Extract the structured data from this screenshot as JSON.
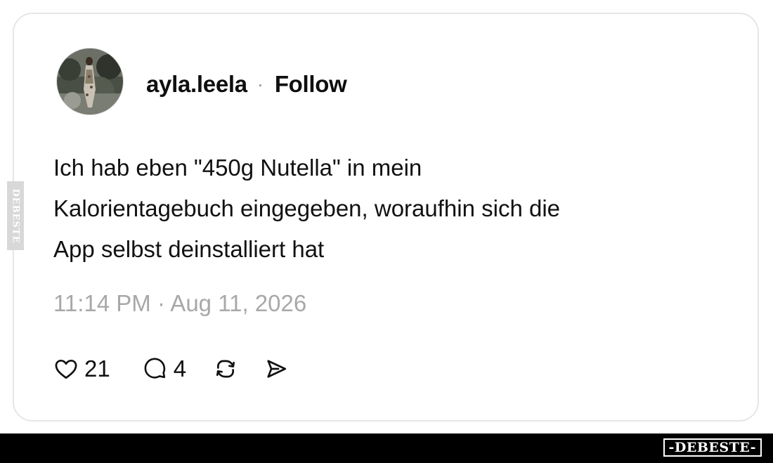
{
  "post": {
    "author": "ayla.leela",
    "separator": "·",
    "follow_label": "Follow",
    "text_lines": [
      "Ich hab eben \"450g Nutella\" in mein",
      "Kalorientagebuch eingegeben, woraufhin sich die",
      "App selbst deinstalliert hat"
    ],
    "timestamp": "11:14 PM · Aug 11, 2026",
    "actions": {
      "like_count": "21",
      "reply_count": "4",
      "like_icon": "heart-icon",
      "reply_icon": "speech-bubble-icon",
      "repost_icon": "repost-icon",
      "share_icon": "send-icon"
    }
  },
  "watermark": {
    "side_text": "DEBESTE",
    "badge_text": "-DEBESTE-"
  },
  "colors": {
    "text": "#0f0f0f",
    "muted": "#a8a8a8",
    "card_border": "#e6e6e6",
    "footer_bar": "#000000"
  }
}
